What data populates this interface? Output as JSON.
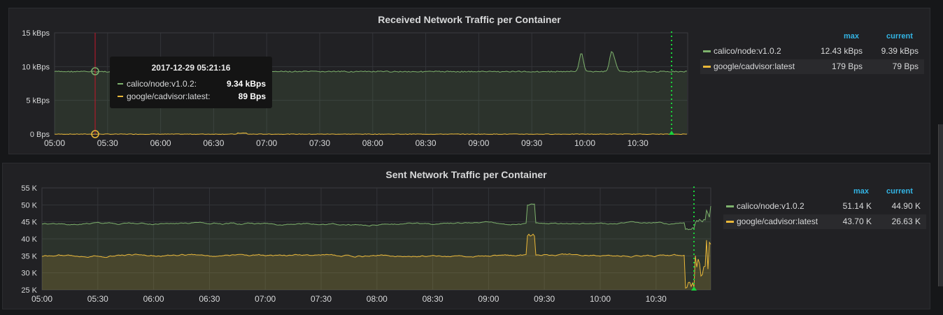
{
  "panels": [
    {
      "title": "Received Network Traffic per Container",
      "legend_headers": {
        "max": "max",
        "current": "current"
      },
      "y_ticks": [
        "0 Bps",
        "5 kBps",
        "10 kBps",
        "15 kBps"
      ],
      "x_ticks": [
        "05:00",
        "05:30",
        "06:00",
        "06:30",
        "07:00",
        "07:30",
        "08:00",
        "08:30",
        "09:00",
        "09:30",
        "10:00",
        "10:30"
      ],
      "series": [
        {
          "name": "calico/node:v1.0.2",
          "max": "12.43 kBps",
          "current": "9.39 kBps",
          "color": "#7eb26d"
        },
        {
          "name": "google/cadvisor:latest",
          "max": "179 Bps",
          "current": "79 Bps",
          "color": "#eab839"
        }
      ],
      "tooltip": {
        "time": "2017-12-29 05:21:16",
        "rows": [
          {
            "name": "calico/node:v1.0.2:",
            "value": "9.34 kBps",
            "color": "#7eb26d"
          },
          {
            "name": "google/cadvisor:latest:",
            "value": "89 Bps",
            "color": "#eab839"
          }
        ]
      }
    },
    {
      "title": "Sent Network Traffic per Container",
      "legend_headers": {
        "max": "max",
        "current": "current"
      },
      "y_ticks": [
        "25 K",
        "30 K",
        "35 K",
        "40 K",
        "45 K",
        "50 K",
        "55 K"
      ],
      "x_ticks": [
        "05:00",
        "05:30",
        "06:00",
        "06:30",
        "07:00",
        "07:30",
        "08:00",
        "08:30",
        "09:00",
        "09:30",
        "10:00",
        "10:30"
      ],
      "series": [
        {
          "name": "calico/node:v1.0.2",
          "max": "51.14 K",
          "current": "44.90 K",
          "color": "#7eb26d"
        },
        {
          "name": "google/cadvisor:latest",
          "max": "43.70 K",
          "current": "26.63 K",
          "color": "#eab839"
        }
      ]
    }
  ],
  "colors": {
    "marker": "#19d43b",
    "crosshair": "#c4162a",
    "legend_header": "#33b5e5"
  }
}
